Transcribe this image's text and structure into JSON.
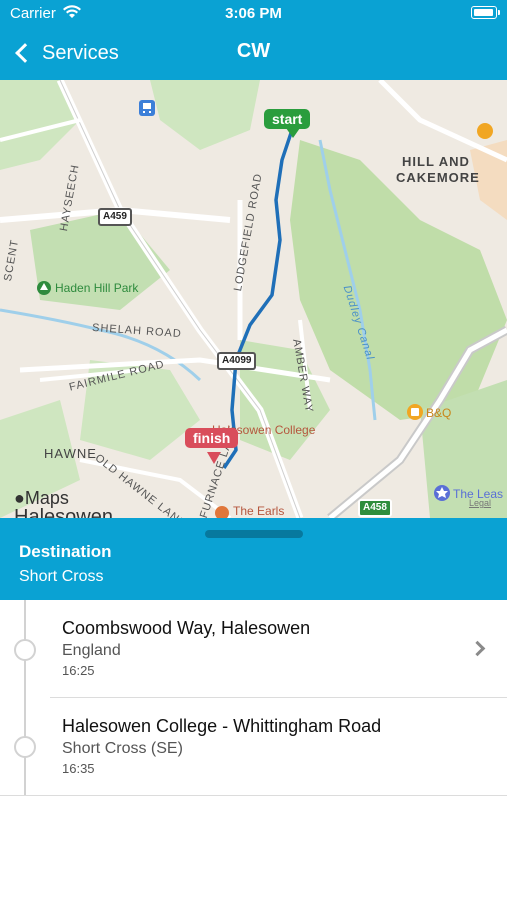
{
  "status_bar": {
    "carrier": "Carrier",
    "time": "3:06 PM"
  },
  "nav": {
    "back_label": "Services",
    "title": "CW"
  },
  "map": {
    "start_label": "start",
    "finish_label": "finish",
    "labels": {
      "hill_and": "HILL AND",
      "cakemore": "CAKEMORE",
      "hayseech": "HAYSEECH",
      "lodgefield_road": "LODGEFIELD ROAD",
      "shelah_road": "SHELAH ROAD",
      "fairmile_road": "FAIRMILE ROAD",
      "amber_way": "AMBER WAY",
      "dudley_canal": "Dudley Canal",
      "hawne": "HAWNE",
      "old_hawne_lane": "OLD HAWNE LANE",
      "furnace_lane": "FURNACE LANE",
      "crescent": "SCENT",
      "halesowen_town": "Halesowen",
      "halesowen_college": "Halesowen College"
    },
    "pois": {
      "haden_hill_park": "Haden Hill Park",
      "bq": "B&Q",
      "the_earls": "The Earls",
      "the_leas": "The Leas"
    },
    "road_badges": {
      "a459": "A459",
      "a4099": "A4099",
      "a458": "A458"
    },
    "attribution": "Maps",
    "legal": "Legal"
  },
  "destination": {
    "label": "Destination",
    "value": "Short Cross"
  },
  "stops": [
    {
      "name": "Coombswood Way, Halesowen",
      "area": "England",
      "time": "16:25"
    },
    {
      "name": "Halesowen College - Whittingham Road",
      "area": "Short Cross (SE)",
      "time": "16:35"
    }
  ],
  "colors": {
    "accent": "#0aa2d3",
    "start_pin": "#2a9d3d",
    "finish_pin": "#d94d5b",
    "route": "#1f6fb8"
  },
  "icons": [
    "wifi-icon",
    "battery-icon",
    "back-chevron-icon",
    "train-station-icon",
    "park-icon",
    "shop-icon",
    "restaurant-icon",
    "star-icon",
    "chevron-right-icon"
  ]
}
